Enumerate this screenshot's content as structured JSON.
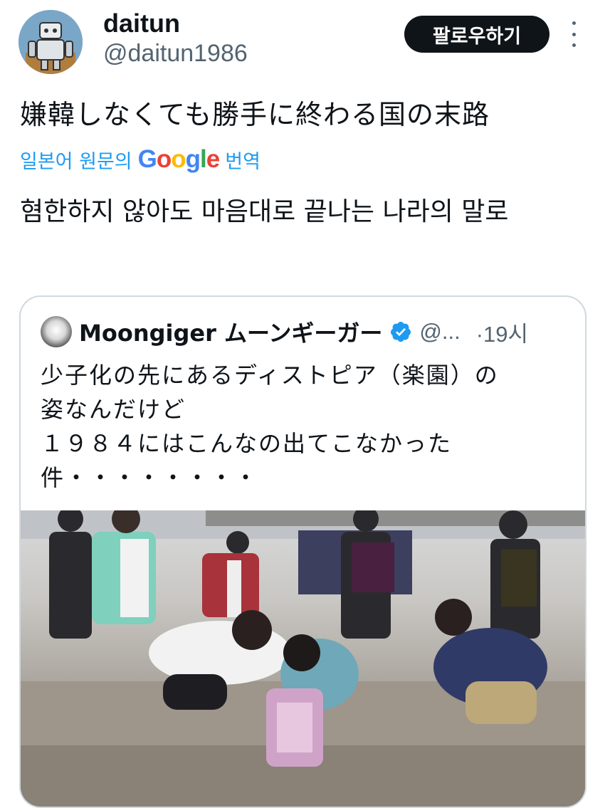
{
  "author": {
    "display_name": "daitun",
    "handle": "@daitun1986",
    "avatar_icon": "robot-avatar"
  },
  "actions": {
    "follow_label": "팔로우하기",
    "more_icon": "more-vertical-icon"
  },
  "tweet": {
    "text": "嫌韓しなくても勝手に終わる国の末路",
    "translate_label_prefix": "일본어 원문의",
    "translate_brand": "Google",
    "translate_label_suffix": "번역",
    "translated_text": "혐한하지 않아도 마음대로 끝나는 나라의 말로"
  },
  "quoted_tweet": {
    "display_name": "Moongiger ムーンギーガー",
    "verified_icon": "verified-badge-icon",
    "handle": "@...",
    "time": "·19시",
    "text": "少子化の先にあるディストピア（楽園）の\n姿なんだけど\n１９８４にはこんなの出てこなかった\n件・・・・・・・・",
    "media": "video-thumbnail"
  },
  "colors": {
    "accent": "#1d9bf0",
    "text_primary": "#0f1419",
    "text_secondary": "#536471",
    "border": "#cfd9de",
    "button_bg": "#0f1419"
  }
}
